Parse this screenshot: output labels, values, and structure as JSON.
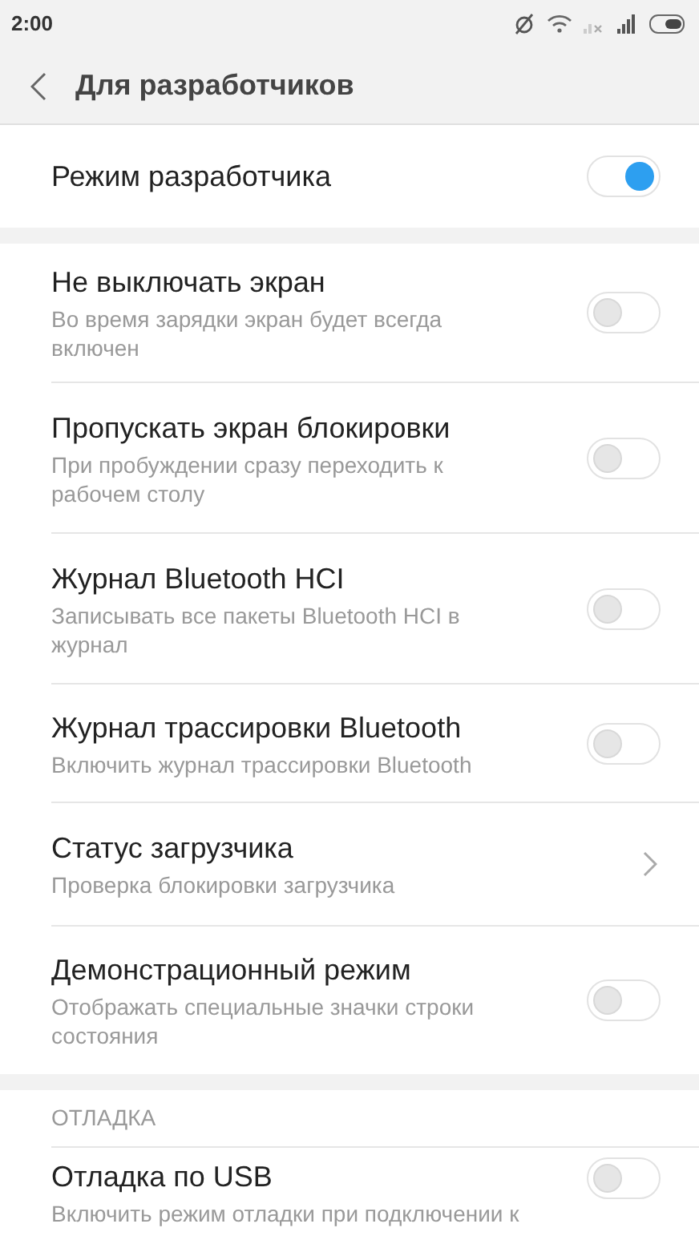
{
  "status_bar": {
    "time": "2:00"
  },
  "header": {
    "title": "Для разработчиков"
  },
  "developer_mode": {
    "label": "Режим разработчика",
    "on": true
  },
  "items": [
    {
      "kind": "toggle",
      "title": "Не выключать экран",
      "subtitle": "Во время зарядки экран будет всегда включен",
      "on": false
    },
    {
      "kind": "toggle",
      "title": "Пропускать экран блокировки",
      "subtitle": "При пробуждении сразу переходить к рабочем столу",
      "on": false
    },
    {
      "kind": "toggle",
      "title": "Журнал Bluetooth HCI",
      "subtitle": "Записывать все пакеты Bluetooth HCI в журнал",
      "on": false
    },
    {
      "kind": "toggle",
      "title": "Журнал трассировки Bluetooth",
      "subtitle": "Включить журнал трассировки Bluetooth",
      "on": false
    },
    {
      "kind": "link",
      "title": "Статус загрузчика",
      "subtitle": "Проверка блокировки загрузчика"
    },
    {
      "kind": "toggle",
      "title": "Демонстрационный режим",
      "subtitle": "Отображать специальные значки строки состояния",
      "on": false
    }
  ],
  "debug_section": {
    "heading": "ОТЛАДКА",
    "items": [
      {
        "kind": "toggle",
        "title": "Отладка по USB",
        "subtitle": "Включить режим отладки при подключении к",
        "on": false
      }
    ]
  }
}
